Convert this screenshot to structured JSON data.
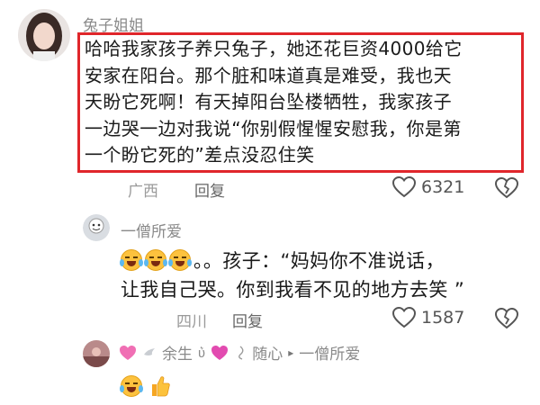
{
  "comment1": {
    "username": "兔子姐姐",
    "lines": [
      "哈哈我家孩子养只兔子，她还花巨资4000给它",
      "安家在阳台。那个脏和味道真是难受，我也天",
      "天盼它死啊！有天掉阳台坠楼牺牲，我家孩子",
      "一边哭一边对我说“你别假惺惺安慰我，你是第",
      "一个盼它死的”差点没忍住笑"
    ],
    "location": "广西",
    "reply_label": "回复",
    "likes": "6321"
  },
  "comment2": {
    "username": "一僧所爱",
    "line1": "。。孩子：“妈妈你不准说话，",
    "line2": "让我自己哭。你到我看不见的地方去笑 ”",
    "location": "四川",
    "reply_label": "回复",
    "likes": "1587"
  },
  "comment3": {
    "username_prefix": "余生",
    "username_symbol": "ʋ͛",
    "username_suffix": "随心",
    "arrow": "▸",
    "reply_to": "一僧所爱"
  },
  "colors": {
    "highlight_border": "#e0262b",
    "meta_gray": "#9a9a9a"
  },
  "icons": {
    "like": "heart-outline-icon",
    "dislike": "broken-heart-icon",
    "emoji": "laughing-tears-emoji",
    "thumbs_up": "thumbs-up-emoji"
  }
}
